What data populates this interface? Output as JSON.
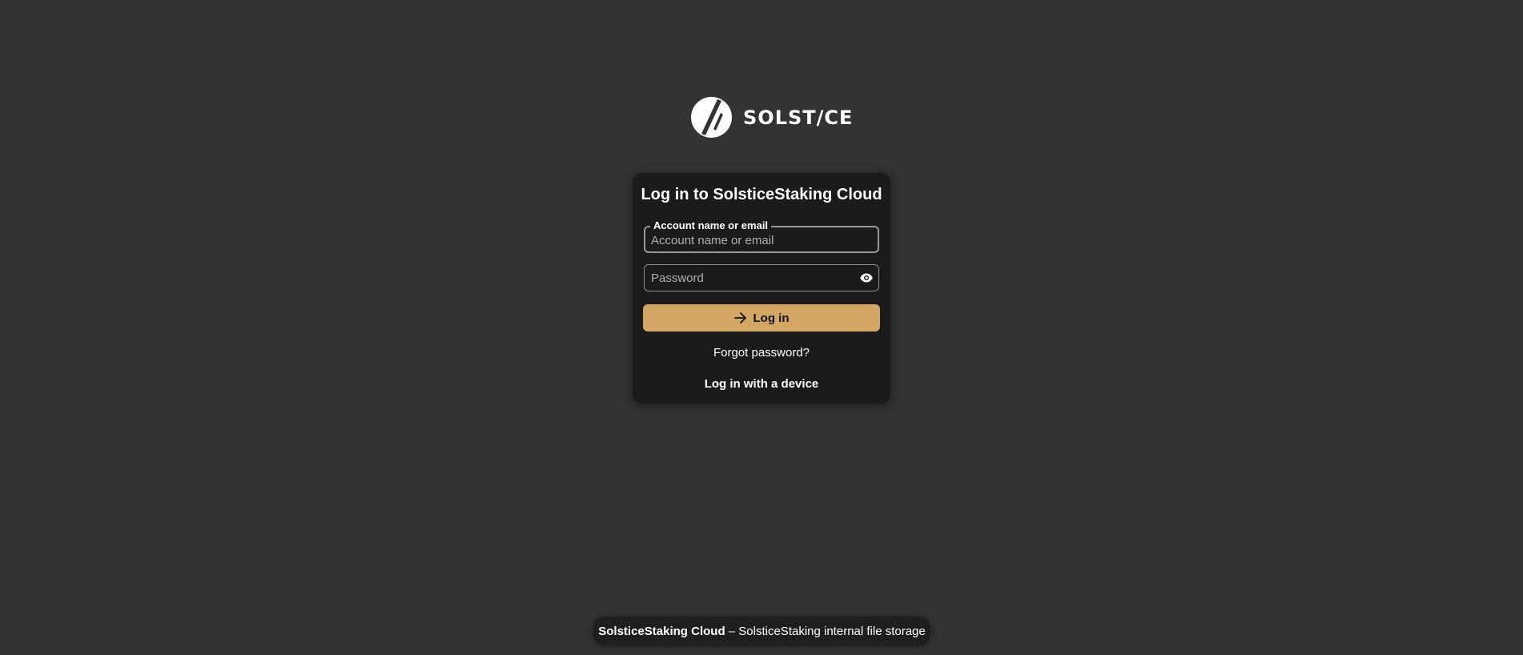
{
  "logo": {
    "text": "SOLST/CE",
    "icon": "solstice-logo-icon"
  },
  "login_card": {
    "title": "Log in to SolsticeStaking Cloud",
    "account_field": {
      "label": "Account name or email",
      "placeholder": "Account name or email",
      "value": ""
    },
    "password_field": {
      "placeholder": "Password",
      "value": "",
      "toggle_icon": "eye-icon"
    },
    "login_button": {
      "label": "Log in",
      "icon": "arrow-right-icon"
    },
    "forgot_password_label": "Forgot password?",
    "device_login_label": "Log in with a device"
  },
  "footer": {
    "brand": "SolsticeStaking Cloud",
    "tagline": " – SolsticeStaking internal file storage"
  },
  "colors": {
    "background": "#333333",
    "card": "#1b1b1b",
    "accent": "#d3a763"
  }
}
